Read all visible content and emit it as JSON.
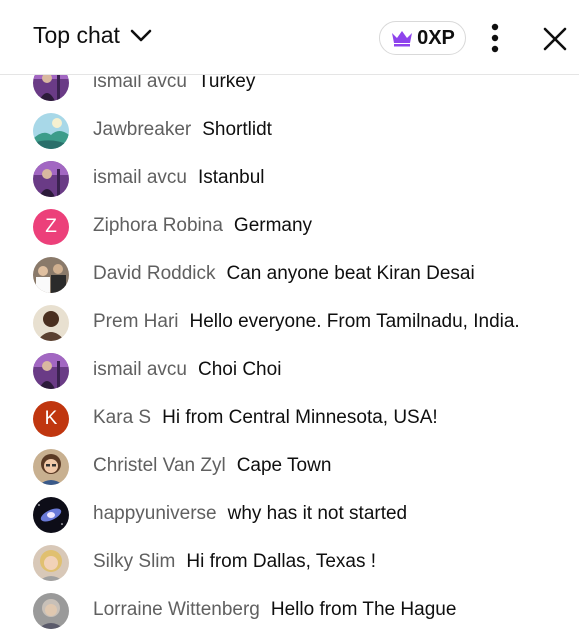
{
  "header": {
    "title": "Top chat",
    "xp_label": "0XP",
    "colors": {
      "crown": "#8e44ec"
    }
  },
  "messages": [
    {
      "author": "ismail avcu",
      "text": "Turkey",
      "avatar": "photo-purple"
    },
    {
      "author": "Jawbreaker",
      "text": "Shortlidt",
      "avatar": "photo-landscape"
    },
    {
      "author": "ismail avcu",
      "text": "Istanbul",
      "avatar": "photo-purple"
    },
    {
      "author": "Ziphora Robina",
      "text": "Germany",
      "avatar": "letter",
      "letter": "Z",
      "color": "#ec407a"
    },
    {
      "author": "David Roddick",
      "text": "Can anyone beat Kiran Desai",
      "avatar": "photo-group"
    },
    {
      "author": "Prem Hari",
      "text": "Hello everyone. From Tamilnadu, India.",
      "avatar": "photo-man"
    },
    {
      "author": "ismail avcu",
      "text": "Choi Choi",
      "avatar": "photo-purple"
    },
    {
      "author": "Kara S",
      "text": "Hi from Central Minnesota, USA!",
      "avatar": "letter",
      "letter": "K",
      "color": "#c0360f"
    },
    {
      "author": "Christel Van Zyl",
      "text": "Cape Town",
      "avatar": "photo-woman"
    },
    {
      "author": "happyuniverse",
      "text": "why has it not started",
      "avatar": "photo-galaxy"
    },
    {
      "author": "Silky Slim",
      "text": "Hi from Dallas, Texas !",
      "avatar": "photo-blonde"
    },
    {
      "author": "Lorraine Wittenberg",
      "text": "Hello from The Hague",
      "avatar": "photo-gray"
    }
  ]
}
